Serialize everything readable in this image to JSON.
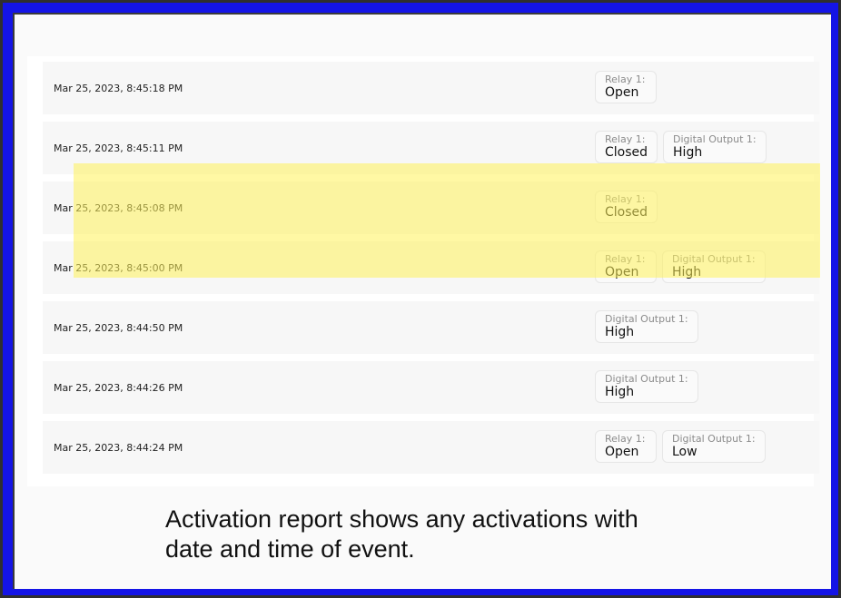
{
  "rows": [
    {
      "timestamp": "Mar 25, 2023, 8:45:18 PM",
      "chips": [
        {
          "label": "Relay 1:",
          "value": "Open"
        }
      ]
    },
    {
      "timestamp": "Mar 25, 2023, 8:45:11 PM",
      "chips": [
        {
          "label": "Relay 1:",
          "value": "Closed"
        },
        {
          "label": "Digital Output 1:",
          "value": "High"
        }
      ]
    },
    {
      "timestamp": "Mar 25, 2023, 8:45:08 PM",
      "chips": [
        {
          "label": "Relay 1:",
          "value": "Closed"
        }
      ]
    },
    {
      "timestamp": "Mar 25, 2023, 8:45:00 PM",
      "chips": [
        {
          "label": "Relay 1:",
          "value": "Open"
        },
        {
          "label": "Digital Output 1:",
          "value": "High"
        }
      ]
    },
    {
      "timestamp": "Mar 25, 2023, 8:44:50 PM",
      "chips": [
        {
          "label": "Digital Output 1:",
          "value": "High"
        }
      ]
    },
    {
      "timestamp": "Mar 25, 2023, 8:44:26 PM",
      "chips": [
        {
          "label": "Digital Output 1:",
          "value": "High"
        }
      ]
    },
    {
      "timestamp": "Mar 25, 2023, 8:44:24 PM",
      "chips": [
        {
          "label": "Relay 1:",
          "value": "Open"
        },
        {
          "label": "Digital Output 1:",
          "value": "Low"
        }
      ]
    }
  ],
  "caption": {
    "line1": "Activation report shows any activations with",
    "line2": "date and time of event."
  },
  "colors": {
    "frame": "#1414e6",
    "highlight": "#fff25a"
  }
}
